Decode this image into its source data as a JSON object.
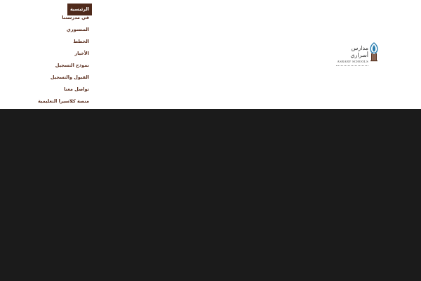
{
  "nav": {
    "items": [
      {
        "label": "الرئيسية",
        "active": true
      },
      {
        "label": "في مدرستنا",
        "active": false
      },
      {
        "label": "المنسوري",
        "active": false
      },
      {
        "label": "الخطط",
        "active": false
      },
      {
        "label": "الأخبار",
        "active": false
      },
      {
        "label": "نموذج التسجيل",
        "active": false
      },
      {
        "label": "القبول والتسجيل",
        "active": false
      },
      {
        "label": "تواصل معنا",
        "active": false
      },
      {
        "label": "منصة كلاسيرا التعليمية",
        "active": false
      }
    ]
  },
  "logo": {
    "arabic_name": "مدارس أسراري",
    "english_name": "ASRARY SCHOOLS",
    "icon": "school-crest-icon"
  },
  "colors": {
    "nav_active_bg": "#4f2a1b",
    "nav_text": "#5b2f1f",
    "logo_blue": "#2b7fb0",
    "logo_brown": "#5a3422",
    "dark_band": "#1b1b1b"
  }
}
